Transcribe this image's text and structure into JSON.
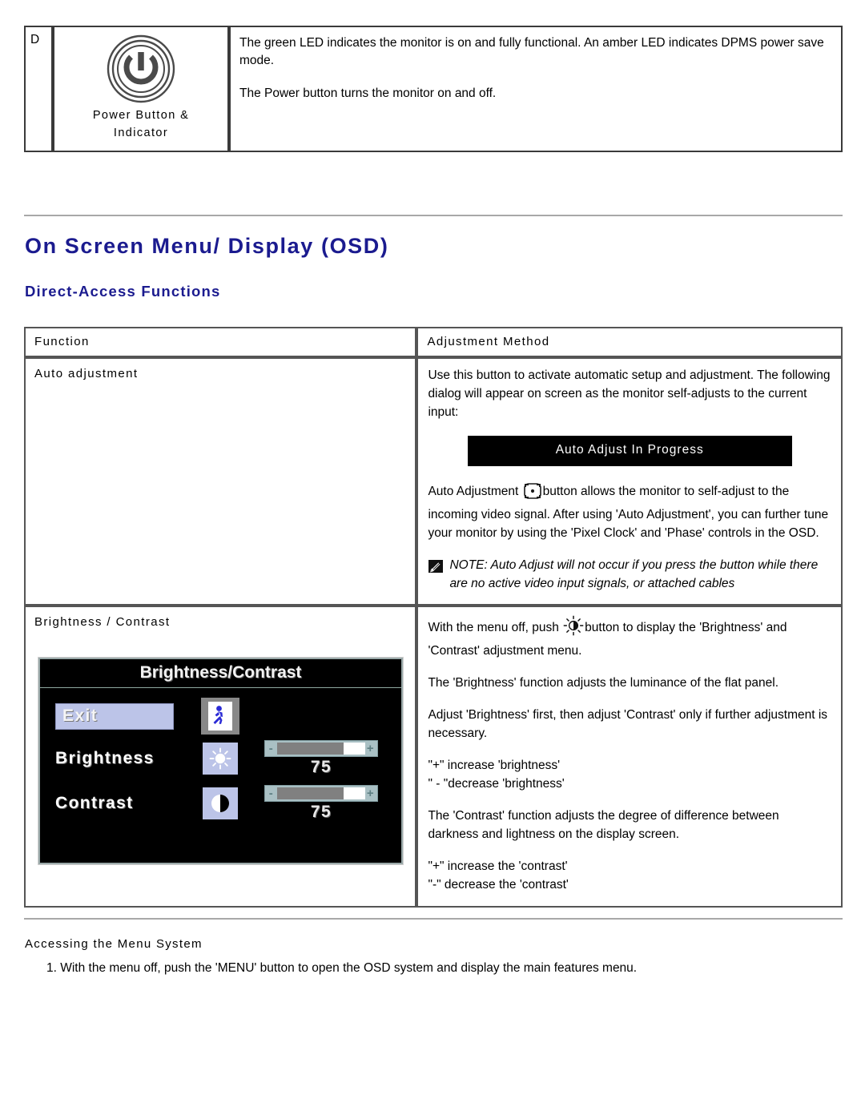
{
  "top_table": {
    "letter": "D",
    "icon_name": "power-button-icon",
    "icon_caption_line1": "Power Button &",
    "icon_caption_line2": "Indicator",
    "desc_paragraph_1": "The green LED indicates the monitor is on and fully functional. An amber LED indicates DPMS power save mode.",
    "desc_paragraph_2": "The Power button turns the monitor on and off."
  },
  "headings": {
    "h1": "On Screen Menu/ Display (OSD)",
    "h2": "Direct-Access Functions",
    "heading_color": "#1b1b8f"
  },
  "fn_table": {
    "headers": {
      "function": "Function",
      "adjustment_method": "Adjustment Method"
    },
    "rows": [
      {
        "function_label": "Auto adjustment",
        "paragraphs": [
          "Use this button to activate automatic setup and adjustment. The following dialog will appear on screen as the monitor self-adjusts to the current input:"
        ],
        "dialog_text": "Auto Adjust In Progress",
        "body_before_icon": "Auto Adjustment ",
        "body_after_icon": "button allows the monitor to self-adjust to the incoming video signal. After using 'Auto Adjustment', you can further tune your monitor by using the 'Pixel Clock' and 'Phase' controls in the OSD.",
        "note_text": "NOTE: Auto Adjust will not occur if you press the button while there are no active video input signals, or attached cables"
      },
      {
        "function_label": "Brightness / Contrast",
        "line1_before_icon": "With the menu off, push ",
        "line1_after_icon": "button to display the 'Brightness' and 'Contrast' adjustment menu.",
        "paragraphs": [
          "The 'Brightness' function adjusts the luminance of the flat panel.",
          "Adjust 'Brightness' first, then adjust 'Contrast' only if further adjustment is necessary."
        ],
        "brightness_plus": "\"+\" increase 'brightness'",
        "brightness_minus": "\" - \"decrease 'brightness'",
        "contrast_desc": "The 'Contrast' function adjusts the degree of difference between darkness and lightness on the display screen.",
        "contrast_plus": "\"+\" increase the 'contrast'",
        "contrast_minus": "\"-\" decrease the 'contrast'"
      }
    ]
  },
  "osd": {
    "title": "Brightness/Contrast",
    "exit_label": "Exit",
    "brightness_label": "Brightness",
    "contrast_label": "Contrast",
    "brightness_value": "75",
    "contrast_value": "75",
    "brightness_percent": 75,
    "contrast_percent": 75,
    "minus_symbol": "-",
    "plus_symbol": "+",
    "highlight_color": "#bcc4e8",
    "slider_frame_color": "#a9c0c4",
    "slider_fill_color": "#808080"
  },
  "bottom": {
    "section_title": "Accessing the Menu System",
    "step_1": "1.  With the menu off, push the 'MENU' button to open the OSD system and display the main features menu."
  }
}
